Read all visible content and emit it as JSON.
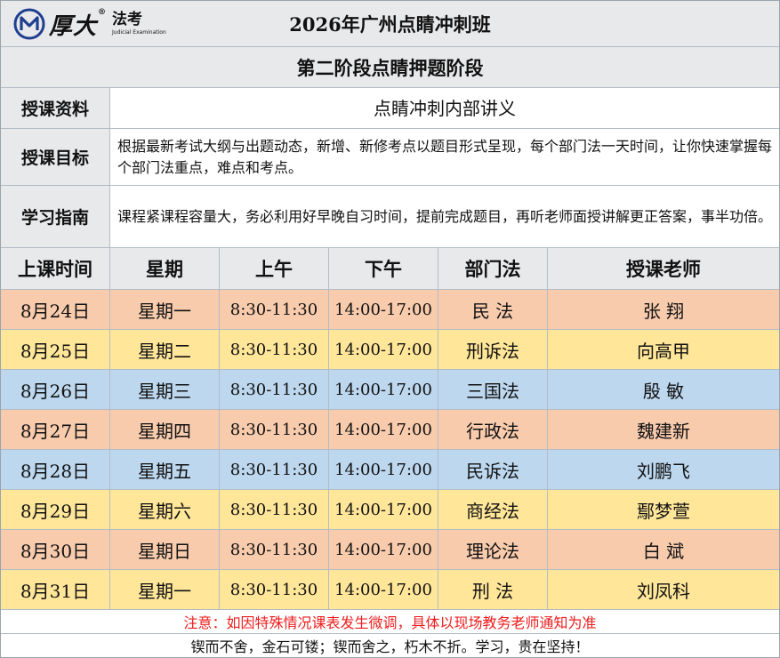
{
  "header": {
    "brand": "厚大",
    "brand_sub_cn": "法考",
    "brand_sub_en": "Judicial Examination",
    "title": "2026年广州点睛冲刺班"
  },
  "stage": "第二阶段点睛押题阶段",
  "info": [
    {
      "label": "授课资料",
      "value": "点睛冲刺内部讲义"
    },
    {
      "label": "授课目标",
      "value": "根据最新考试大纲与出题动态，新增、新修考点以题目形式呈现，每个部门法一天时间，让你快速掌握每个部门法重点，难点和考点。"
    },
    {
      "label": "学习指南",
      "value": "课程紧课程容量大，务必利用好早晚自习时间，提前完成题目，再听老师面授讲解更正答案，事半功倍。"
    }
  ],
  "columns": [
    "上课时间",
    "星期",
    "上午",
    "下午",
    "部门法",
    "授课老师"
  ],
  "rows": [
    {
      "date": "8月24日",
      "weekday": "星期一",
      "am": "8:30-11:30",
      "pm": "14:00-17:00",
      "subject": "民 法",
      "teacher": "张 翔",
      "color": "#f8cbad"
    },
    {
      "date": "8月25日",
      "weekday": "星期二",
      "am": "8:30-11:30",
      "pm": "14:00-17:00",
      "subject": "刑诉法",
      "teacher": "向高甲",
      "color": "#ffe699"
    },
    {
      "date": "8月26日",
      "weekday": "星期三",
      "am": "8:30-11:30",
      "pm": "14:00-17:00",
      "subject": "三国法",
      "teacher": "殷 敏",
      "color": "#bdd7ee"
    },
    {
      "date": "8月27日",
      "weekday": "星期四",
      "am": "8:30-11:30",
      "pm": "14:00-17:00",
      "subject": "行政法",
      "teacher": "魏建新",
      "color": "#f8cbad"
    },
    {
      "date": "8月28日",
      "weekday": "星期五",
      "am": "8:30-11:30",
      "pm": "14:00-17:00",
      "subject": "民诉法",
      "teacher": "刘鹏飞",
      "color": "#bdd7ee"
    },
    {
      "date": "8月29日",
      "weekday": "星期六",
      "am": "8:30-11:30",
      "pm": "14:00-17:00",
      "subject": "商经法",
      "teacher": "鄢梦萱",
      "color": "#ffe699"
    },
    {
      "date": "8月30日",
      "weekday": "星期日",
      "am": "8:30-11:30",
      "pm": "14:00-17:00",
      "subject": "理论法",
      "teacher": "白 斌",
      "color": "#f8cbad"
    },
    {
      "date": "8月31日",
      "weekday": "星期一",
      "am": "8:30-11:30",
      "pm": "14:00-17:00",
      "subject": "刑 法",
      "teacher": "刘凤科",
      "color": "#ffe699"
    }
  ],
  "notice": "注意：如因特殊情况课表发生微调，具体以现场教务老师通知为准",
  "motto": "锲而不舍，金石可镂；锲而舍之，朽木不折。学习，贵在坚持！",
  "colors": {
    "header_gray": "#e8e9eb",
    "notice_red": "#ee1c1c",
    "logo_blue": "#1f3f8f"
  }
}
